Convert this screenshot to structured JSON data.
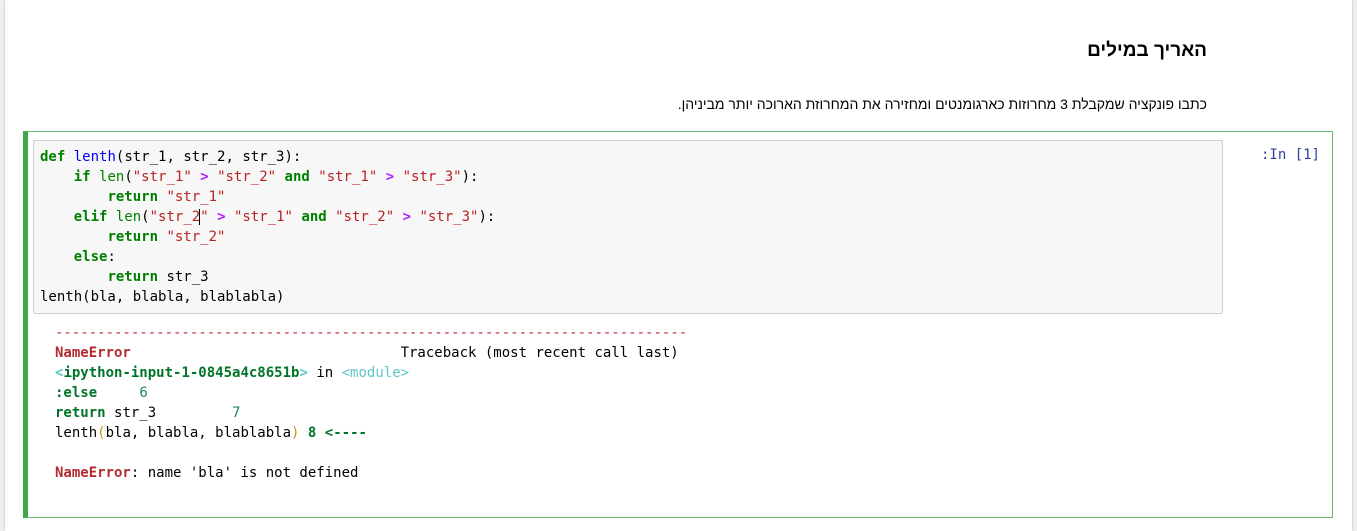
{
  "markdown": {
    "heading": "האריך במילים",
    "paragraph": "כתבו פונקציה שמקבלת 3 מחרוזות כארגומנטים ומחזירה את המחרוזת הארוכה יותר מביניהן."
  },
  "cell": {
    "prompt": ":In [1]",
    "code": {
      "def_kw": "def",
      "func_name": "lenth",
      "params": "(str_1, str_2, str_3):",
      "if_kw": "if",
      "len": "len",
      "s_str1": "\"str_1\"",
      "s_str2": "\"str_2\"",
      "s_str3": "\"str_3\"",
      "s_str2_a": "\"str_2",
      "s_str2_b": "\"",
      "gt": ">",
      "and_kw": "and",
      "return_kw": "return",
      "elif_kw": "elif",
      "else_kw": "else",
      "ret_var": "str_3",
      "call": "lenth(bla, blabla, blablabla)"
    },
    "output": {
      "dashes": "---------------------------------------------------------------------------",
      "error_name": "NameError",
      "traceback_label": "Traceback (most recent call last)",
      "input_ref": "<ipython-input-1-0845a4c8651b>",
      "in_word": "in",
      "module_ref": "<module>",
      "line6_code": ":else",
      "line6_num": "6",
      "line7_code_kw": "return",
      "line7_code_rest": "str_3",
      "line7_num": "7",
      "line8_fn": "lenth",
      "line8_args": "bla, blabla, blablabla",
      "line8_num": "8",
      "arrow": "<----",
      "error_message": ": name 'bla' is not defined"
    }
  },
  "colors": {
    "cell_border": "#42a548",
    "prompt": "#303f9f",
    "error": "#b22b31",
    "keyword": "#008000",
    "string": "#ba2121",
    "operator": "#aa22ff"
  }
}
